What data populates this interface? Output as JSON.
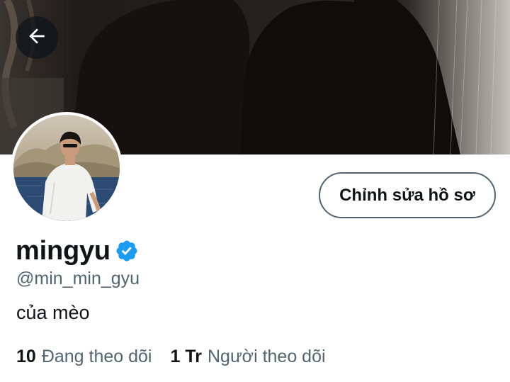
{
  "header": {
    "back_icon": "arrow-left-icon"
  },
  "profile": {
    "edit_button_label": "Chỉnh sửa hồ sơ",
    "display_name": "mingyu",
    "verified_icon": "verified-badge-icon",
    "handle": "@min_min_gyu",
    "bio": "của mèo"
  },
  "stats": {
    "following_count": "10",
    "following_label": "Đang theo dõi",
    "followers_count": "1 Tr",
    "followers_label": "Người theo dõi"
  },
  "colors": {
    "accent": "#1d9bf0",
    "secondary_text": "#536471",
    "primary_text": "#0f1419"
  }
}
